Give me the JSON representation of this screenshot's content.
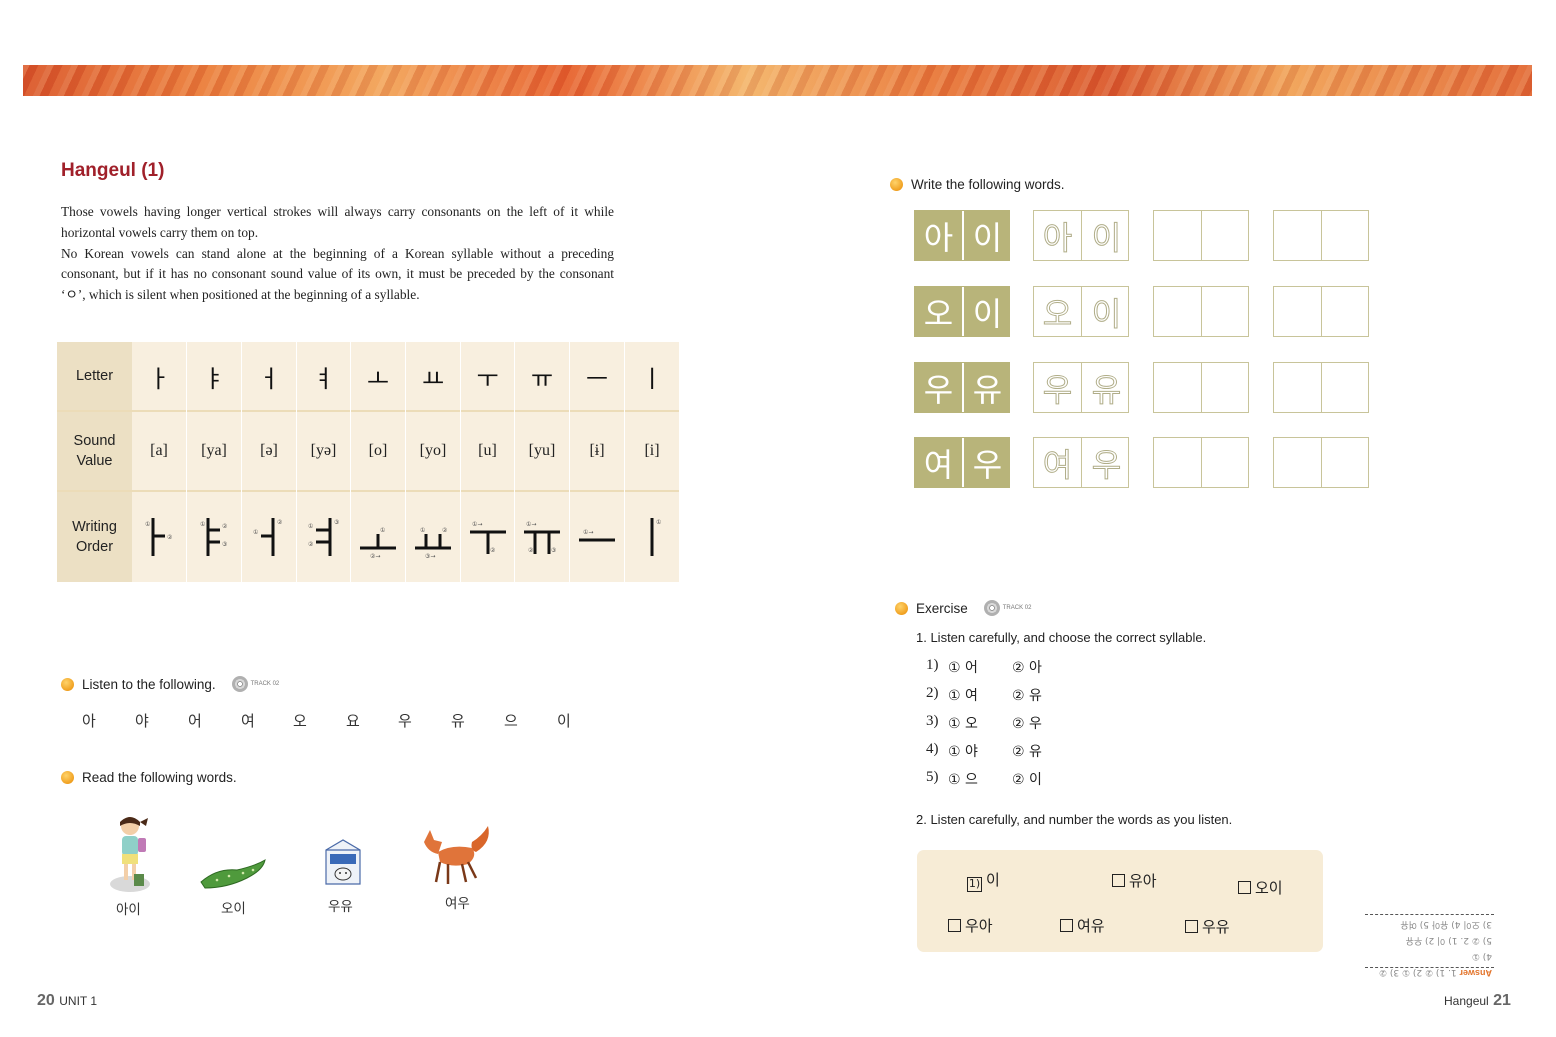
{
  "left_page": {
    "title": "Hangeul (1)",
    "intro": [
      "Those vowels having longer vertical strokes will always carry consonants on the left of it while horizontal vowels carry them on top.",
      "No Korean vowels can stand alone at the beginning of a Korean syllable without a preceding consonant, but if it has no consonant sound value of its own, it must be preceded by the consonant ‘ㅇ’, which is silent when positioned at the beginning of a syllable."
    ],
    "table": {
      "row_headers": [
        "Letter",
        "Sound Value",
        "Writing Order"
      ],
      "letters": [
        "ㅏ",
        "ㅑ",
        "ㅓ",
        "ㅕ",
        "ㅗ",
        "ㅛ",
        "ㅜ",
        "ㅠ",
        "ㅡ",
        "ㅣ"
      ],
      "sounds": [
        "[a]",
        "[ya]",
        "[ə]",
        "[yə]",
        "[o]",
        "[yo]",
        "[u]",
        "[yu]",
        "[ɨ]",
        "[i]"
      ]
    },
    "listen": {
      "label": "Listen to the following.",
      "track": "TRACK 02",
      "syllables": [
        "아",
        "야",
        "어",
        "여",
        "오",
        "요",
        "우",
        "유",
        "으",
        "이"
      ]
    },
    "read": {
      "label": "Read the following words.",
      "words": [
        "아이",
        "오이",
        "우유",
        "여우"
      ]
    },
    "folio_number": "20",
    "folio_text": "UNIT 1"
  },
  "right_page": {
    "write": {
      "label": "Write the following words.",
      "rows": [
        [
          "아",
          "이"
        ],
        [
          "오",
          "이"
        ],
        [
          "우",
          "유"
        ],
        [
          "여",
          "우"
        ]
      ]
    },
    "exercise": {
      "label": "Exercise",
      "track": "TRACK 02",
      "q1": {
        "prompt": "1. Listen carefully, and choose the correct syllable.",
        "items": [
          {
            "num": "1)",
            "a": "① 어",
            "b": "② 아"
          },
          {
            "num": "2)",
            "a": "① 여",
            "b": "② 유"
          },
          {
            "num": "3)",
            "a": "① 오",
            "b": "② 우"
          },
          {
            "num": "4)",
            "a": "① 야",
            "b": "② 유"
          },
          {
            "num": "5)",
            "a": "① 으",
            "b": "② 이"
          }
        ]
      },
      "q2": {
        "prompt": "2. Listen carefully, and number the words as you listen.",
        "example_number": "1)",
        "words": [
          "이",
          "유아",
          "오이",
          "우아",
          "여유",
          "우유"
        ]
      }
    },
    "answer_key": {
      "label": "Answer",
      "lines": [
        "1. 1) ② 2) ① 3) ② 4) ①",
        "5) ② 2. 1) 이 2) 우유",
        "3) 오이 4) 유아 5) 여유"
      ]
    },
    "folio_number": "21",
    "folio_text": "Hangeul"
  }
}
